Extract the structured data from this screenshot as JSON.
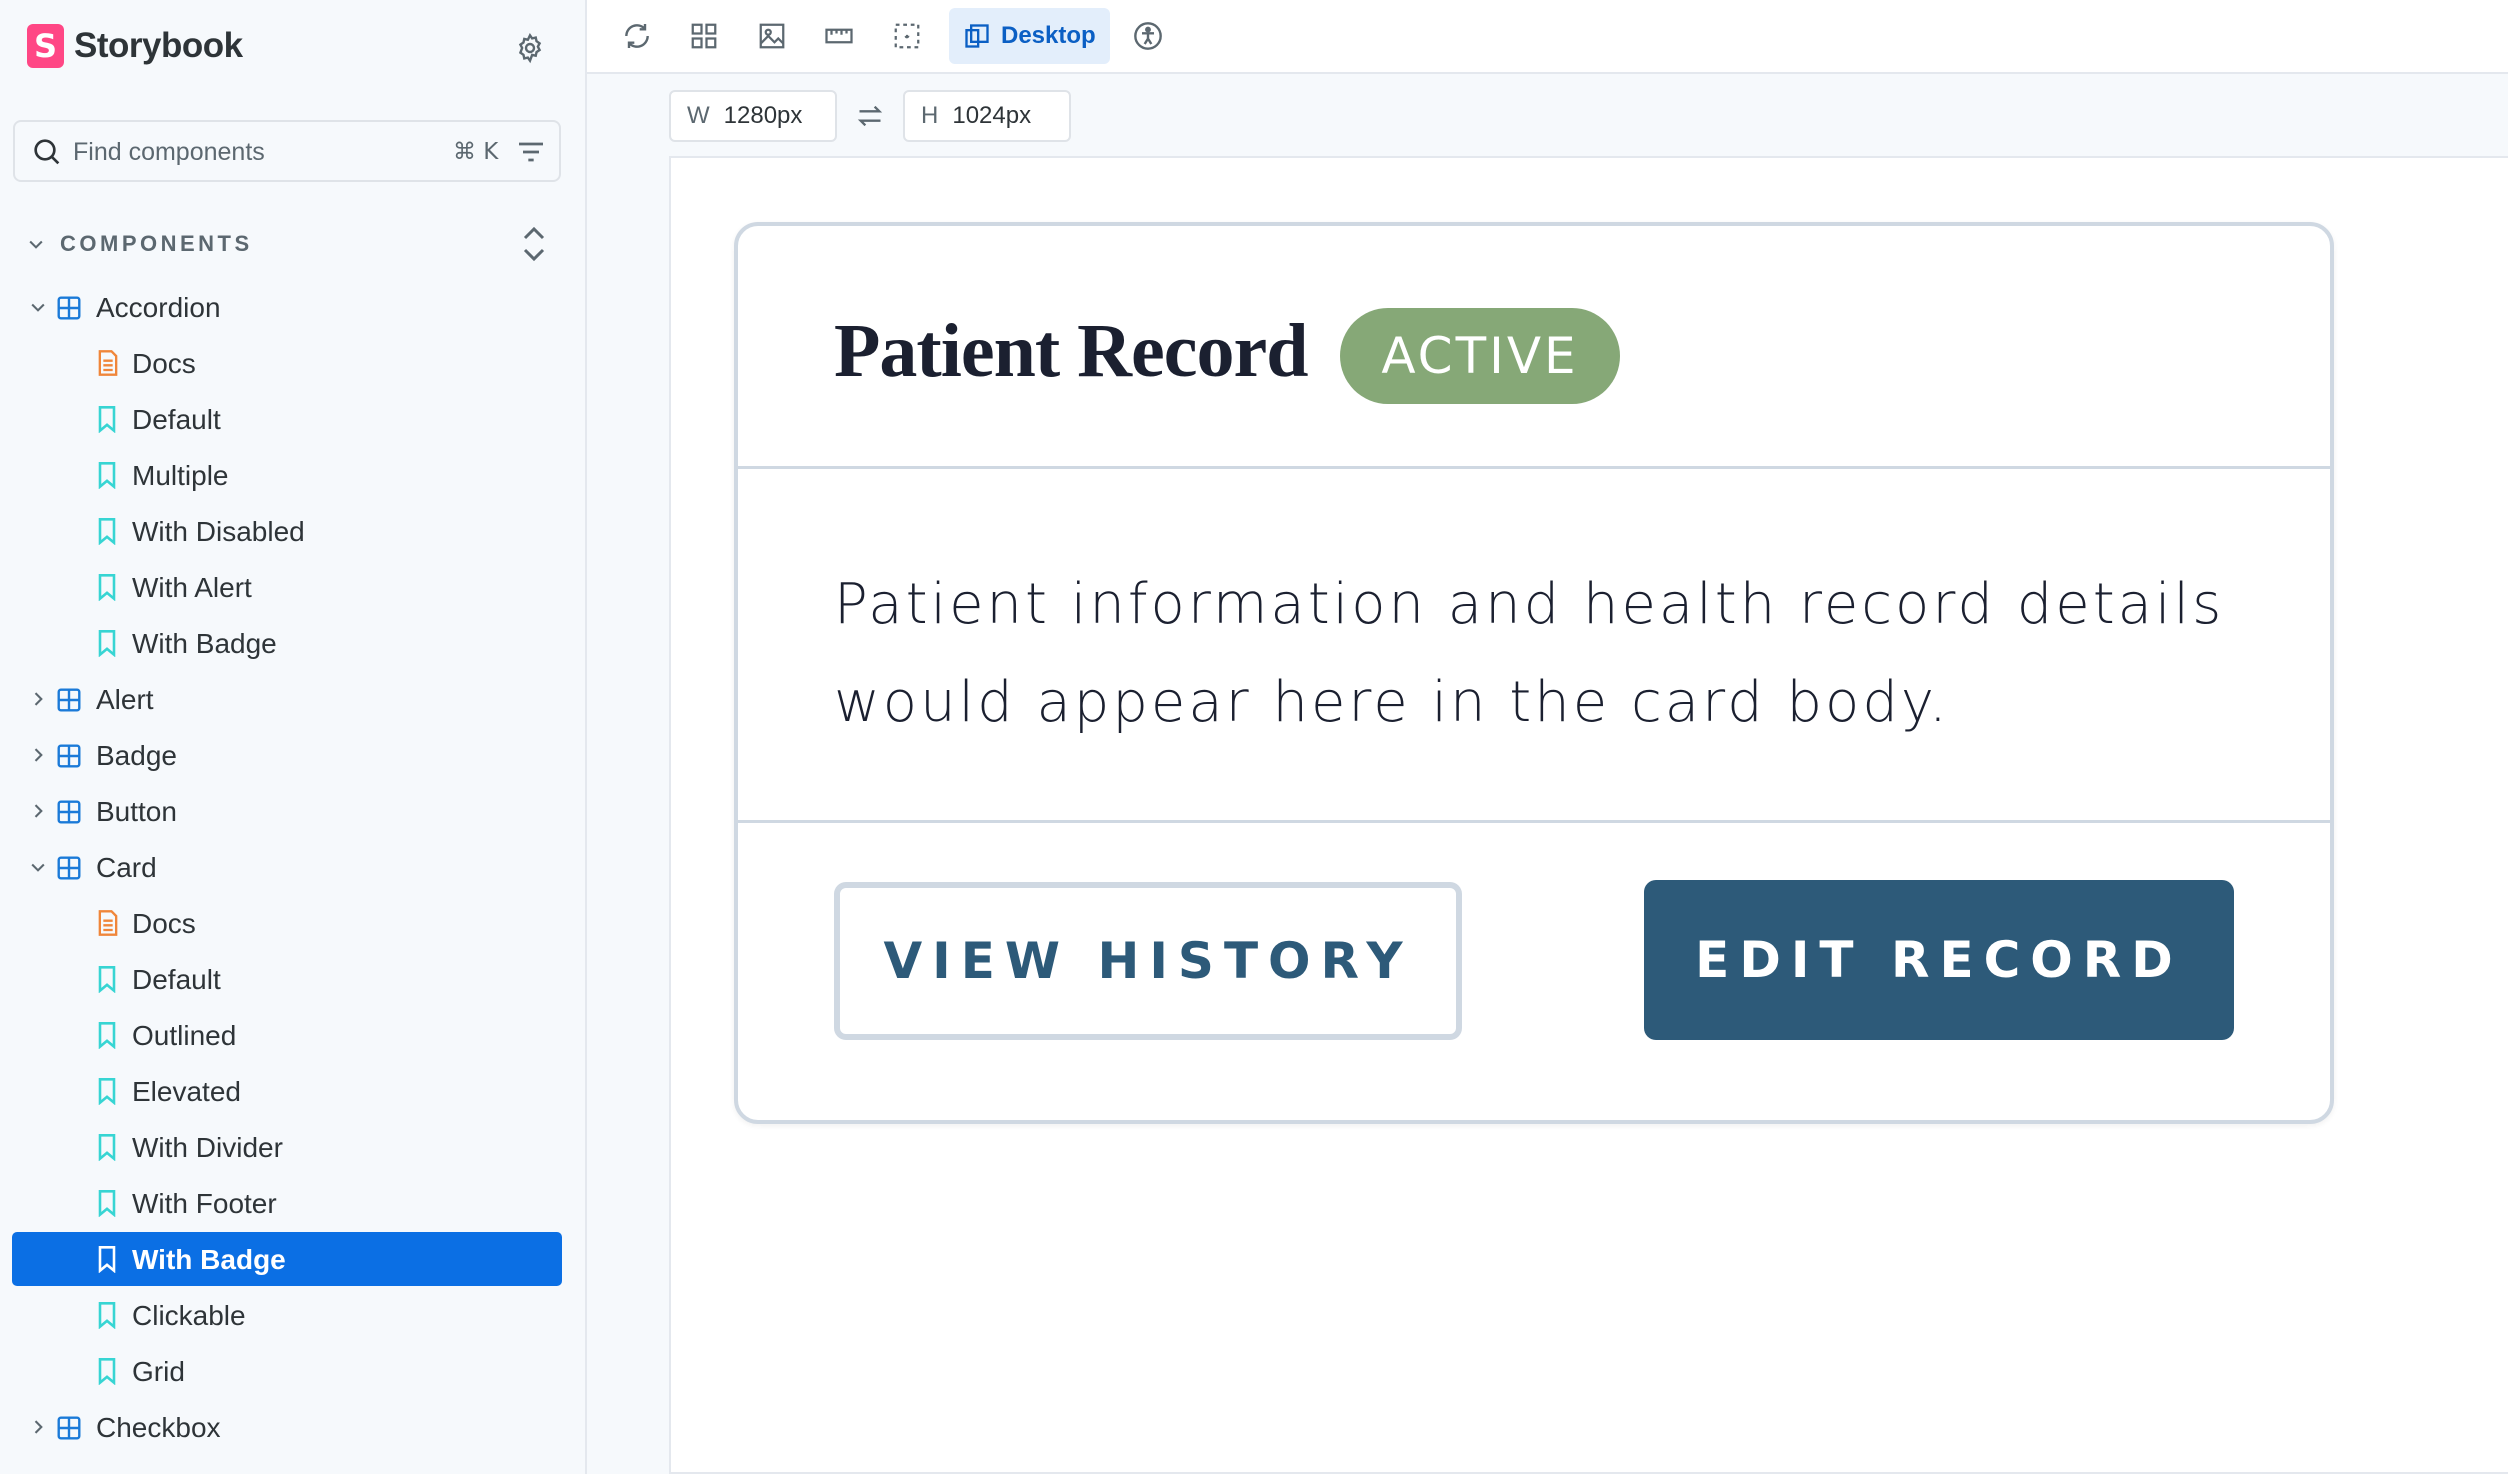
{
  "app": {
    "name": "Storybook",
    "logo_letter": "S"
  },
  "search": {
    "placeholder": "Find components",
    "shortcut": "⌘ K"
  },
  "sidebar": {
    "section_title": "COMPONENTS",
    "tree": [
      {
        "type": "component",
        "label": "Accordion",
        "expanded": true
      },
      {
        "type": "docs",
        "label": "Docs"
      },
      {
        "type": "story",
        "label": "Default"
      },
      {
        "type": "story",
        "label": "Multiple"
      },
      {
        "type": "story",
        "label": "With Disabled"
      },
      {
        "type": "story",
        "label": "With Alert"
      },
      {
        "type": "story",
        "label": "With Badge"
      },
      {
        "type": "component",
        "label": "Alert",
        "expanded": false
      },
      {
        "type": "component",
        "label": "Badge",
        "expanded": false
      },
      {
        "type": "component",
        "label": "Button",
        "expanded": false
      },
      {
        "type": "component",
        "label": "Card",
        "expanded": true
      },
      {
        "type": "docs",
        "label": "Docs"
      },
      {
        "type": "story",
        "label": "Default"
      },
      {
        "type": "story",
        "label": "Outlined"
      },
      {
        "type": "story",
        "label": "Elevated"
      },
      {
        "type": "story",
        "label": "With Divider"
      },
      {
        "type": "story",
        "label": "With Footer"
      },
      {
        "type": "story",
        "label": "With Badge",
        "selected": true
      },
      {
        "type": "story",
        "label": "Clickable"
      },
      {
        "type": "story",
        "label": "Grid"
      },
      {
        "type": "component",
        "label": "Checkbox",
        "expanded": false
      }
    ]
  },
  "toolbar": {
    "viewport_label": "Desktop",
    "icons": [
      "reload-icon",
      "grid-icon",
      "background-icon",
      "measure-icon",
      "outline-icon",
      "viewport-icon",
      "accessibility-icon"
    ]
  },
  "viewport": {
    "width_key": "W",
    "width_value": "1280px",
    "height_key": "H",
    "height_value": "1024px"
  },
  "card": {
    "title": "Patient Record",
    "badge": "ACTIVE",
    "body": "Patient information and health record details would appear here in the card body.",
    "secondary_button": "VIEW HISTORY",
    "primary_button": "EDIT RECORD"
  },
  "colors": {
    "brand": "#ff4785",
    "selection": "#0b6fe4",
    "component_icon": "#1b7ad8",
    "docs_icon": "#f0863a",
    "story_icon": "#37d5d3",
    "badge": "#86a877",
    "primary_button": "#2d5a79"
  }
}
